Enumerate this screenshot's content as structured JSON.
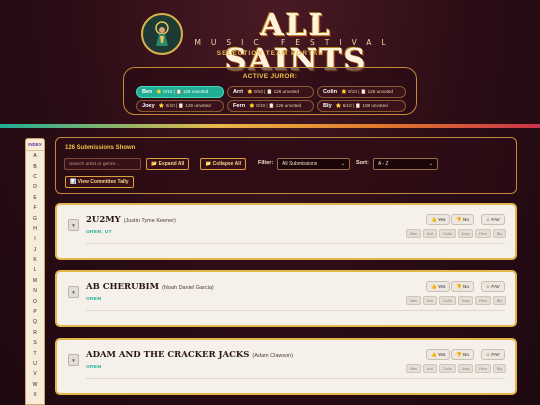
{
  "header": {
    "brand": "ALL SAINTS",
    "subtitle": "MUSIC FESTIVAL",
    "portal": "SELECTION TEAM PORTAL",
    "active_juror_label": "ACTIVE JUROR:"
  },
  "jurors": [
    {
      "name": "Bex",
      "stats": "⭐ 0/10 | 📋 126 unvoted",
      "active": true
    },
    {
      "name": "Arri",
      "stats": "⭐ 0/10 | 📋 126 unvoted",
      "active": false
    },
    {
      "name": "Colin",
      "stats": "⭐ 0/10 | 📋 126 unvoted",
      "active": false
    },
    {
      "name": "Joey",
      "stats": "⭐ 0/10 | 📋 126 unvoted",
      "active": false
    },
    {
      "name": "Fern",
      "stats": "⭐ 0/10 | 📋 126 unvoted",
      "active": false
    },
    {
      "name": "Bly",
      "stats": "⭐ 5/10 | 📋 108 unvoted",
      "active": false
    }
  ],
  "index": {
    "title": "INDEX",
    "letters": [
      "A",
      "B",
      "C",
      "D",
      "E",
      "F",
      "G",
      "H",
      "I",
      "J",
      "K",
      "L",
      "M",
      "N",
      "O",
      "P",
      "Q",
      "R",
      "S",
      "T",
      "U",
      "V",
      "W",
      "X"
    ]
  },
  "controls": {
    "shown": "126 Submissions Shown",
    "search_placeholder": "Search artist or genre...",
    "expand": "📂 Expand All",
    "collapse": "📁 Collapse All",
    "filter_label": "Filter:",
    "filter_value": "All Submissions",
    "sort_label": "Sort:",
    "sort_value": "A - Z",
    "tally": "📊 View Committee Tally"
  },
  "card_labels": {
    "toggle": "▼",
    "yes": "👍 Yes",
    "no": "👎 No",
    "fav": "☆ FAV",
    "juror_tags": [
      "Bex",
      "Arri",
      "Colin",
      "Joey",
      "Fern",
      "Bly"
    ]
  },
  "submissions": [
    {
      "band": "2U2MY",
      "artist": "(Justin Tyme Keener)",
      "city": "OREM, UT"
    },
    {
      "band": "AB CHERUBIM",
      "artist": "(Noah Daniel Garcia)",
      "city": "OREM"
    },
    {
      "band": "ADAM AND THE CRACKER JACKS",
      "artist": "(Adam Clawson)",
      "city": "OREM"
    }
  ],
  "colors": {
    "accent": "#1fae94",
    "gold": "#e3b64a",
    "background": "#2a0c14"
  }
}
